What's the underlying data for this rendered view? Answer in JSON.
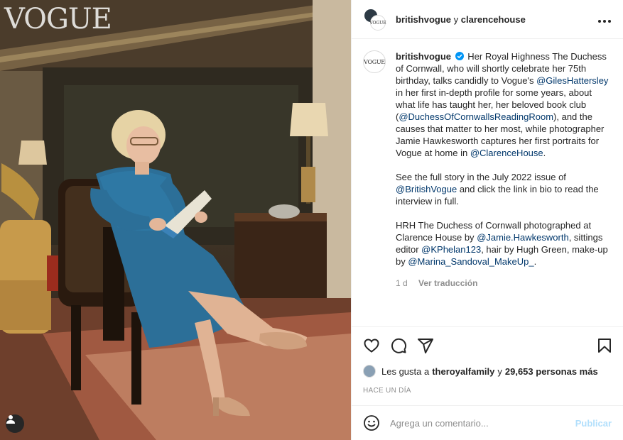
{
  "photo": {
    "watermark": "VOGUE",
    "tag_icon": "user-tag-icon"
  },
  "header": {
    "user1": "britishvogue",
    "separator": "y",
    "user2": "clarencehouse",
    "more_icon": "more-options-icon",
    "avatar2_text": "VOGUE"
  },
  "caption": {
    "avatar_text": "VOGUE",
    "username": "britishvogue",
    "p1_a": "Her Royal Highness The Duchess of Cornwall, who will shortly celebrate her 75th birthday, talks candidly to Vogue's",
    "mention_giles": "@GilesHattersley",
    "p1_b": "in her first in-depth profile for some years, about what life has taught her, her beloved book club (",
    "mention_readingroom": "@DuchessOfCornwallsReadingRoom",
    "p1_c": "), and the causes that matter to her most, while photographer Jamie Hawkesworth captures her first portraits for Vogue at home in",
    "mention_clarence": "@ClarenceHouse",
    "p1_d": ".",
    "p2_a": "See the full story in the July 2022 issue of",
    "mention_britishvogue": "@BritishVogue",
    "p2_b": "and click the link in bio to read the interview in full.",
    "p3_a": "HRH The Duchess of Cornwall photographed at Clarence House by",
    "mention_jamie": "@Jamie.Hawkesworth",
    "p3_b": ", sittings editor",
    "mention_kphelan": "@KPhelan123",
    "p3_c": ", hair by Hugh Green, make-up by",
    "mention_marina": "@Marina_Sandoval_MakeUp_",
    "p3_d": ".",
    "age": "1 d",
    "translate": "Ver traducción"
  },
  "actions": {
    "like_icon": "heart-icon",
    "comment_icon": "comment-icon",
    "share_icon": "share-icon",
    "save_icon": "bookmark-icon"
  },
  "likes": {
    "prefix": "Les gusta a",
    "user": "theroyalfamily",
    "middle": "y",
    "count": "29,653 personas más"
  },
  "timestamp": "HACE UN DÍA",
  "comment_box": {
    "placeholder": "Agrega un comentario...",
    "publish_label": "Publicar",
    "emoji_icon": "emoji-icon"
  },
  "colors": {
    "link": "#00376b",
    "verified": "#0095f6",
    "publish_disabled": "#b2dffc",
    "muted": "#8e8e8e"
  }
}
